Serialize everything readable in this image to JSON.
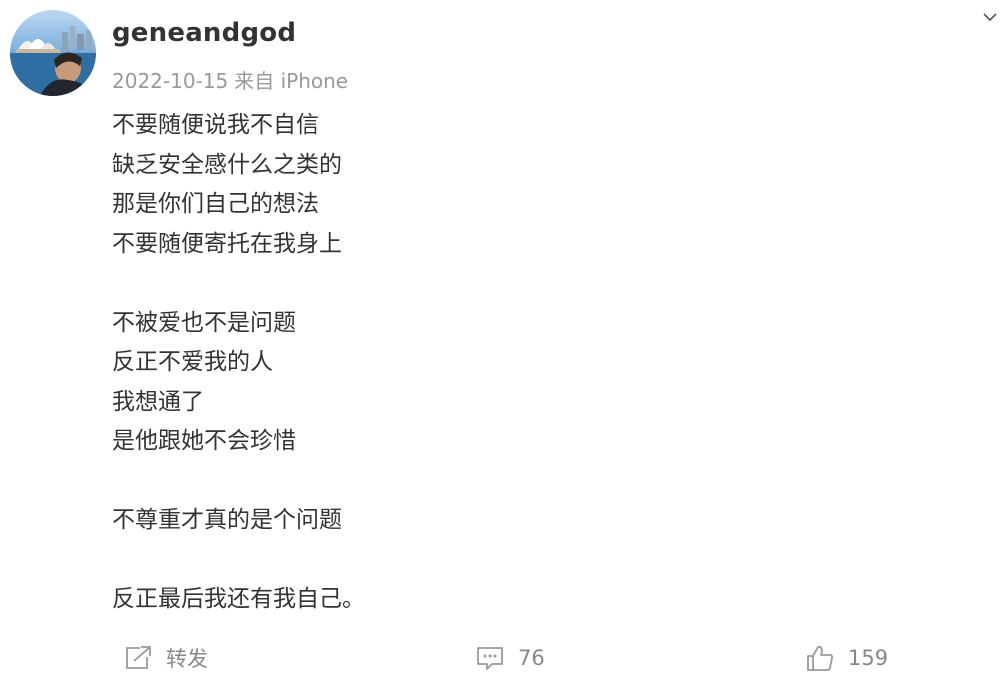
{
  "post": {
    "username": "geneandgod",
    "date": "2022-10-15",
    "source": "来自 iPhone",
    "lines": [
      "不要随便说我不自信",
      "缺乏安全感什么之类的",
      "那是你们自己的想法",
      "不要随便寄托在我身上",
      "",
      "不被爱也不是问题",
      "反正不爱我的人",
      "我想通了",
      "是他跟她不会珍惜",
      "",
      "不尊重才真的是个问题",
      "",
      "反正最后我还有我自己。"
    ]
  },
  "actions": {
    "repost_label": "转发",
    "comment_count": "76",
    "like_count": "159"
  },
  "icons": {
    "menu": "chevron-down-icon",
    "repost": "repost-icon",
    "comment": "comment-icon",
    "like": "thumbs-up-icon"
  },
  "colors": {
    "text": "#333333",
    "meta": "#999999",
    "action": "#888888"
  }
}
